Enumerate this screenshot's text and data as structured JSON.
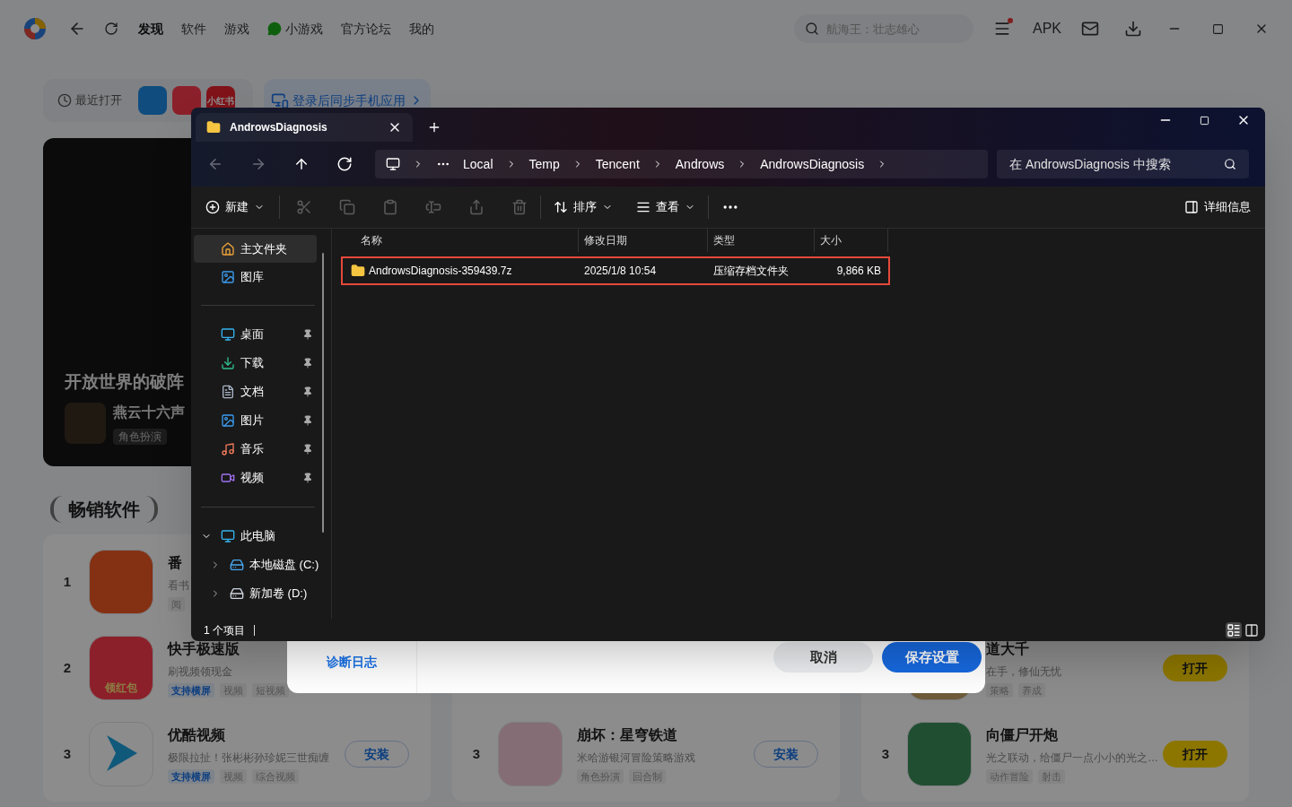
{
  "app": {
    "nav": [
      {
        "label": "发现",
        "selected": true,
        "kind": "plain"
      },
      {
        "label": "软件",
        "selected": false,
        "kind": "plain"
      },
      {
        "label": "游戏",
        "selected": false,
        "kind": "plain"
      },
      {
        "label": "小游戏",
        "selected": false,
        "kind": "mini"
      },
      {
        "label": "官方论坛",
        "selected": false,
        "kind": "plain"
      },
      {
        "label": "我的",
        "selected": false,
        "kind": "plain"
      }
    ],
    "search": {
      "placeholder": "航海王：壮志雄心"
    },
    "notification": true,
    "apk": "APK"
  },
  "recent": {
    "label": "最近打开",
    "apps": [
      {
        "kind": "reader"
      },
      {
        "kind": "kuaishou"
      },
      {
        "kind": "redbook",
        "text": "小红书"
      }
    ],
    "sync": "登录后同步手机应用"
  },
  "banner": {
    "title": "开放世界的破阵",
    "game": "燕云十六声",
    "tag": "角色扮演"
  },
  "section": "畅销软件",
  "columns": [
    [
      {
        "rank": "1",
        "name": "番",
        "desc": "看书",
        "kind": "tomato",
        "tags": [
          {
            "label": "阅",
            "kind": "plain"
          }
        ]
      },
      {
        "rank": "2",
        "name": "快手极速版",
        "desc": "刷视频领现金",
        "kind": "kuaishou",
        "icon_text": "领红包",
        "tags": [
          {
            "label": "支持横屏",
            "kind": "feature"
          },
          {
            "label": "视频",
            "kind": "plain"
          },
          {
            "label": "短视频",
            "kind": "plain"
          }
        ]
      },
      {
        "rank": "3",
        "name": "优酷视频",
        "desc": "极限拉扯！张彬彬孙珍妮三世痴缠",
        "kind": "youku",
        "action": {
          "label": "安装",
          "kind": "install"
        },
        "tags": [
          {
            "label": "支持横屏",
            "kind": "feature"
          },
          {
            "label": "视频",
            "kind": "plain"
          },
          {
            "label": "综合视频",
            "kind": "plain"
          }
        ]
      }
    ],
    [
      {
        "rank": "3",
        "name": "崩坏：星穹铁道",
        "desc": "米哈游银河冒险策略游戏",
        "kind": "anime",
        "action": {
          "label": "安装",
          "kind": "install"
        },
        "tags": [
          {
            "label": "角色扮演",
            "kind": "plain"
          },
          {
            "label": "回合制",
            "kind": "plain"
          }
        ]
      }
    ],
    [
      {
        "name": "道大千",
        "desc": "在手，修仙无忧",
        "kind": "fantasy",
        "action": {
          "label": "打开",
          "kind": "open"
        },
        "tags": [
          {
            "label": "策略",
            "kind": "plain"
          },
          {
            "label": "养成",
            "kind": "plain"
          }
        ]
      },
      {
        "rank": "3",
        "name": "向僵尸开炮",
        "desc": "光之联动，给僵尸一点小小的光之…",
        "kind": "zombie",
        "action": {
          "label": "打开",
          "kind": "open"
        },
        "tags": [
          {
            "label": "动作冒险",
            "kind": "plain"
          },
          {
            "label": "射击",
            "kind": "plain"
          }
        ]
      }
    ]
  ],
  "dialog": {
    "nav": [
      {
        "label": "诊断日志",
        "selected": true
      }
    ],
    "buttons": [
      {
        "label": "取消",
        "kind": "secondary"
      },
      {
        "label": "保存设置",
        "kind": "primary"
      }
    ]
  },
  "explorer": {
    "tab": {
      "title": "AndrowsDiagnosis"
    },
    "nav": [
      {
        "kind": "back",
        "disabled": true
      },
      {
        "kind": "forward",
        "disabled": true
      },
      {
        "kind": "up",
        "disabled": false
      },
      {
        "kind": "refresh",
        "disabled": false
      }
    ],
    "path": [
      "Local",
      "Temp",
      "Tencent",
      "Androws",
      "AndrowsDiagnosis"
    ],
    "search": {
      "placeholder": "在 AndrowsDiagnosis 中搜索"
    },
    "toolbar": {
      "new": "新建",
      "actions": [
        {
          "kind": "cut",
          "disabled": true
        },
        {
          "kind": "copy",
          "disabled": true
        },
        {
          "kind": "paste",
          "disabled": true
        },
        {
          "kind": "rename",
          "disabled": true
        },
        {
          "kind": "share",
          "disabled": true
        },
        {
          "kind": "delete",
          "disabled": true
        }
      ],
      "sort": "排序",
      "view": "查看",
      "details": "详细信息"
    },
    "sidebar": {
      "top": [
        {
          "label": "主文件夹",
          "kind": "home",
          "selected": true
        },
        {
          "label": "图库",
          "kind": "gallery",
          "selected": false
        }
      ],
      "pinned": [
        {
          "label": "桌面",
          "kind": "desktop",
          "selected": false,
          "pinned": true
        },
        {
          "label": "下载",
          "kind": "download",
          "selected": false,
          "pinned": true
        },
        {
          "label": "文档",
          "kind": "documents",
          "selected": false,
          "pinned": true
        },
        {
          "label": "图片",
          "kind": "pictures",
          "selected": false,
          "pinned": true
        },
        {
          "label": "音乐",
          "kind": "music",
          "selected": false,
          "pinned": true
        },
        {
          "label": "视频",
          "kind": "videos",
          "selected": false,
          "pinned": true
        }
      ],
      "tree": [
        {
          "label": "此电脑",
          "kind": "pc",
          "expanded": true,
          "children": [
            {
              "label": "本地磁盘 (C:)",
              "kind": "system_drive",
              "expanded": false
            },
            {
              "label": "新加卷 (D:)",
              "kind": "drive",
              "expanded": false
            }
          ]
        }
      ]
    },
    "columns": [
      "名称",
      "修改日期",
      "类型",
      "大小"
    ],
    "files": [
      {
        "name": "AndrowsDiagnosis-359439.7z",
        "modified": "2025/1/8 10:54",
        "type": "压缩存档文件夹",
        "size": "9,866 KB",
        "highlighted": true
      }
    ],
    "status": "1 个项目",
    "views": [
      {
        "kind": "details",
        "selected": true
      },
      {
        "kind": "tiles",
        "selected": false
      }
    ]
  }
}
